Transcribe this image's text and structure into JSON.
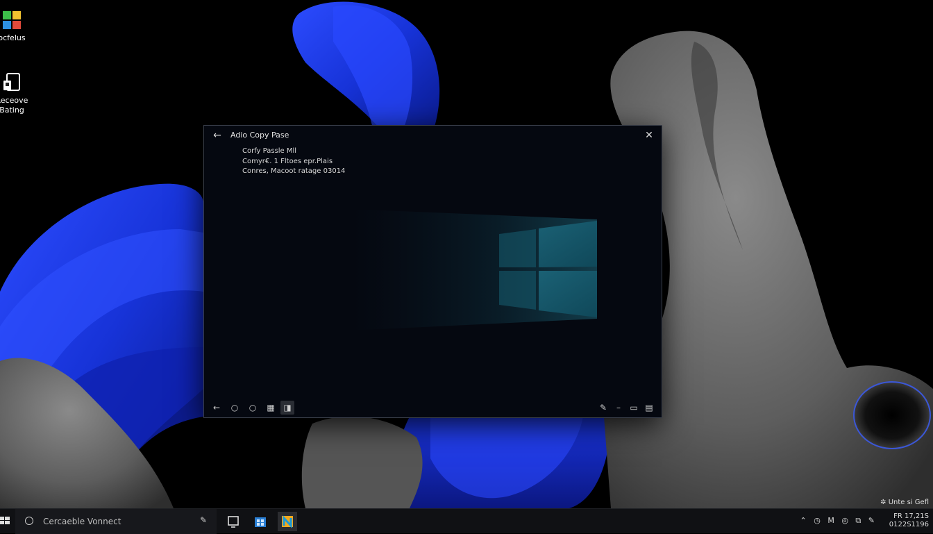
{
  "desktop": {
    "icons": [
      {
        "label": "ocfelus",
        "icon": "photos-grid-icon"
      },
      {
        "label": "Receove\nBating",
        "icon": "device-icon"
      }
    ]
  },
  "window": {
    "title": "Adio Copy Pase",
    "lines": [
      "Corfy Passle Mll",
      "Comyr€. 1 Fltoes epr.Plais",
      "Conres, Macoot ratage 03014"
    ],
    "toolbar_left": [
      "back-arrow-icon",
      "circle-icon",
      "circle-icon",
      "grid-icon",
      "bookmark-icon"
    ],
    "toolbar_right": [
      "pen-icon",
      "minus-icon",
      "window-icon",
      "grid-icon"
    ]
  },
  "taskbar": {
    "search_placeholder": "Cercaeble Vonnect",
    "apps": [
      "screen-share-icon",
      "store-icon",
      "app-icon"
    ],
    "tray_icons": [
      "chevron-up-icon",
      "clock-icon",
      "m-icon",
      "chat-icon",
      "volume-icon",
      "pen-icon"
    ],
    "tray_glyphs": [
      "⌃",
      "◷",
      "M",
      "◎",
      "⧉",
      "✎"
    ],
    "clock_line1": "FR 17,21S",
    "clock_line2": "0122S1196"
  },
  "corner_notice": "✲ Unte si Gefl",
  "colors": {
    "accent_blue": "#1f3be0",
    "window_bg": "#050810",
    "taskbar_bg": "#101114"
  }
}
